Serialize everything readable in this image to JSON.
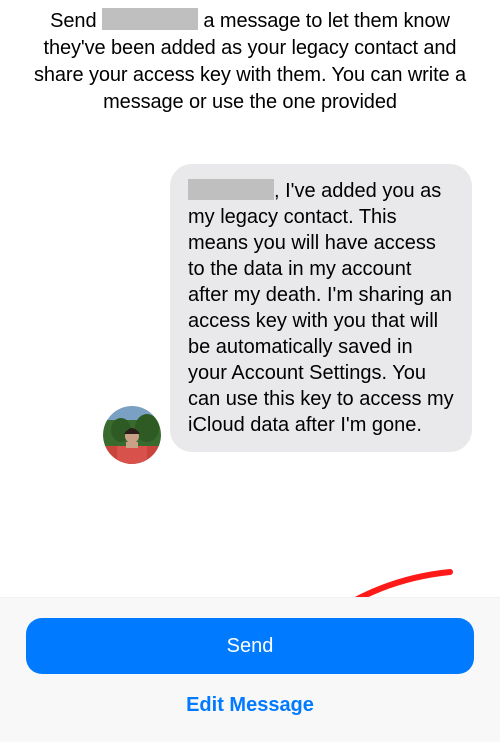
{
  "instruction": {
    "prefix": "Send ",
    "suffix": " a message to let them know they've been added as your legacy contact and share your access key with them. You can write a message or use the one provided"
  },
  "message": {
    "redacted_name_placeholder": "",
    "body_after_name": ", I've added you as my legacy contact. This means you will have access to the data in my account after my death. I'm sharing an access key with you that will be automatically saved in your Account Settings. You can use this key to access my iCloud data after I'm gone."
  },
  "buttons": {
    "send": "Send",
    "edit": "Edit Message"
  },
  "colors": {
    "primary": "#007aff",
    "bubble": "#e9e9eb",
    "redaction": "#bfbfbf",
    "arrow": "#ff1a1a"
  },
  "avatar": {
    "semantic": "contact-avatar",
    "description": "Person in red shirt outdoors with green trees"
  }
}
